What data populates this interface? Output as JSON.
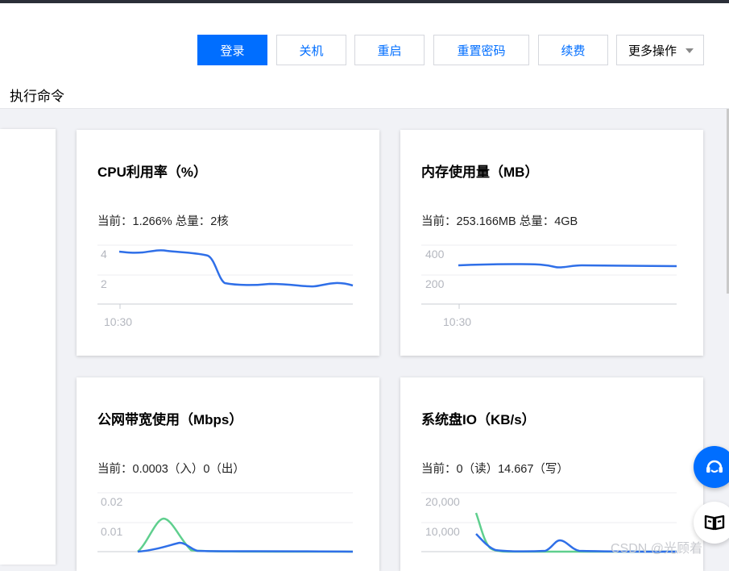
{
  "header": {
    "buttons": {
      "login": "登录",
      "shutdown": "关机",
      "restart": "重启",
      "reset_password": "重置密码",
      "renew": "续费",
      "more": "更多操作"
    },
    "tab": "执行命令"
  },
  "cards": {
    "cpu": {
      "title": "CPU利用率（%）",
      "current": "当前：1.266% 总量：2核",
      "y_ticks": [
        "4",
        "2"
      ],
      "x_ticks": [
        "10:30"
      ]
    },
    "memory": {
      "title": "内存使用量（MB）",
      "current": "当前：253.166MB 总量：4GB",
      "y_ticks": [
        "400",
        "200"
      ],
      "x_ticks": [
        "10:30"
      ]
    },
    "bandwidth": {
      "title": "公网带宽使用（Mbps）",
      "current": "当前：0.0003（入）0（出）",
      "y_ticks": [
        "0.02",
        "0.01"
      ]
    },
    "disk": {
      "title": "系统盘IO（KB/s）",
      "current": "当前：0（读）14.667（写）",
      "y_ticks": [
        "20,000",
        "10,000"
      ]
    }
  },
  "colors": {
    "primary": "#006eff",
    "line_blue": "#2f6fe8",
    "line_green": "#5fcf8e"
  },
  "watermark": "CSDN @光顾着"
}
